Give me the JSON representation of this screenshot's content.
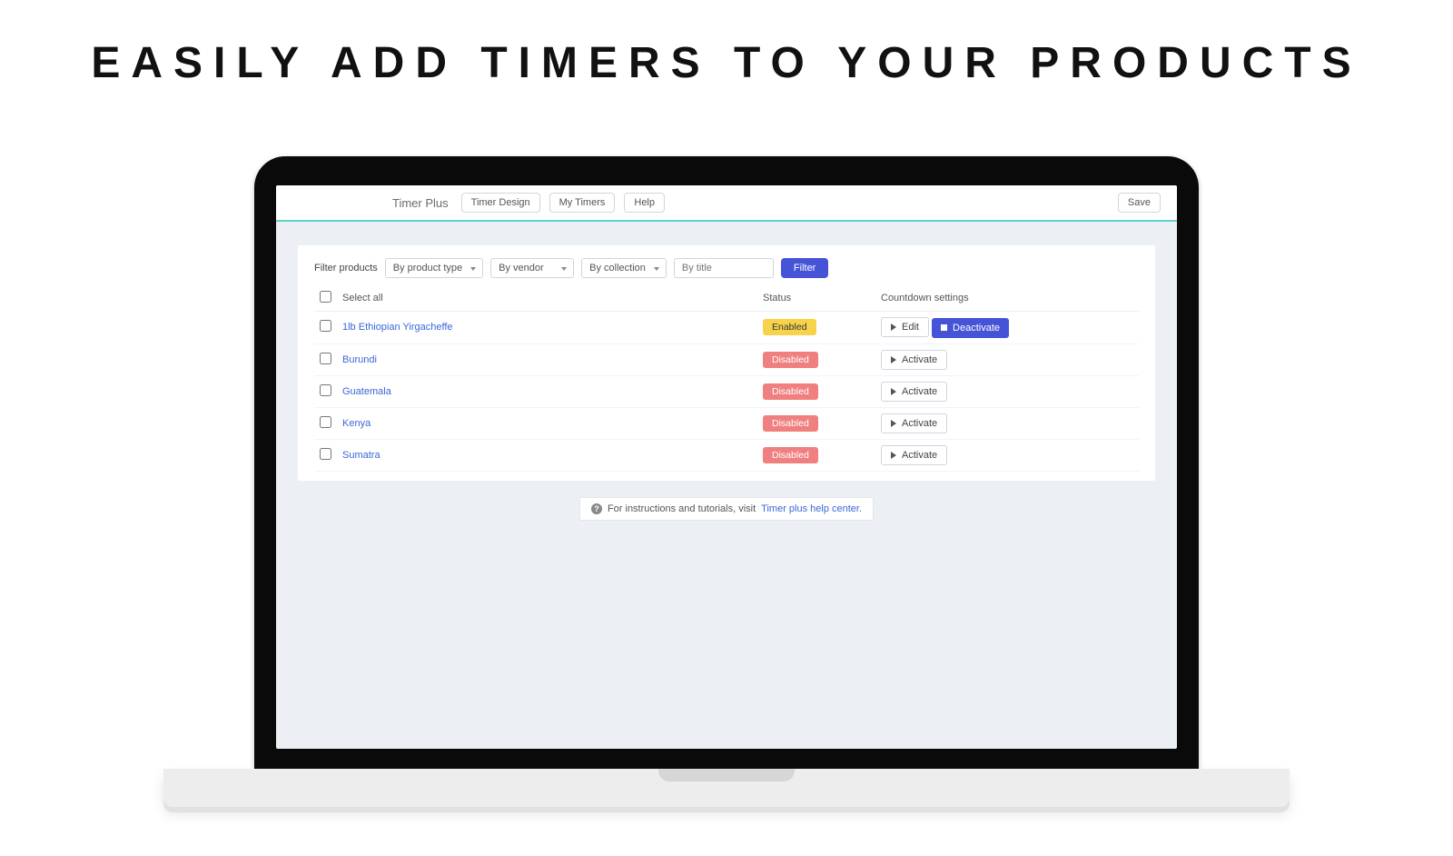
{
  "headline": "EASILY ADD TIMERS TO YOUR PRODUCTS",
  "topbar": {
    "brand": "Timer Plus",
    "nav": [
      "Timer Design",
      "My Timers",
      "Help"
    ],
    "save": "Save"
  },
  "filter": {
    "label": "Filter products",
    "product_type": "By product type",
    "vendor": "By vendor",
    "collection": "By collection",
    "title_placeholder": "By title",
    "button": "Filter"
  },
  "table": {
    "select_all": "Select all",
    "status": "Status",
    "settings": "Countdown settings",
    "rows": [
      {
        "name": "1lb Ethiopian Yirgacheffe",
        "status": "Enabled",
        "status_class": "b-enabled",
        "edit": "Edit",
        "deactivate": "Deactivate"
      },
      {
        "name": "Burundi",
        "status": "Disabled",
        "status_class": "b-disabled",
        "activate": "Activate"
      },
      {
        "name": "Guatemala",
        "status": "Disabled",
        "status_class": "b-disabled",
        "activate": "Activate"
      },
      {
        "name": "Kenya",
        "status": "Disabled",
        "status_class": "b-disabled",
        "activate": "Activate"
      },
      {
        "name": "Sumatra",
        "status": "Disabled",
        "status_class": "b-disabled",
        "activate": "Activate"
      }
    ]
  },
  "footer": {
    "text": "For instructions and tutorials, visit ",
    "link": "Timer plus help center."
  }
}
